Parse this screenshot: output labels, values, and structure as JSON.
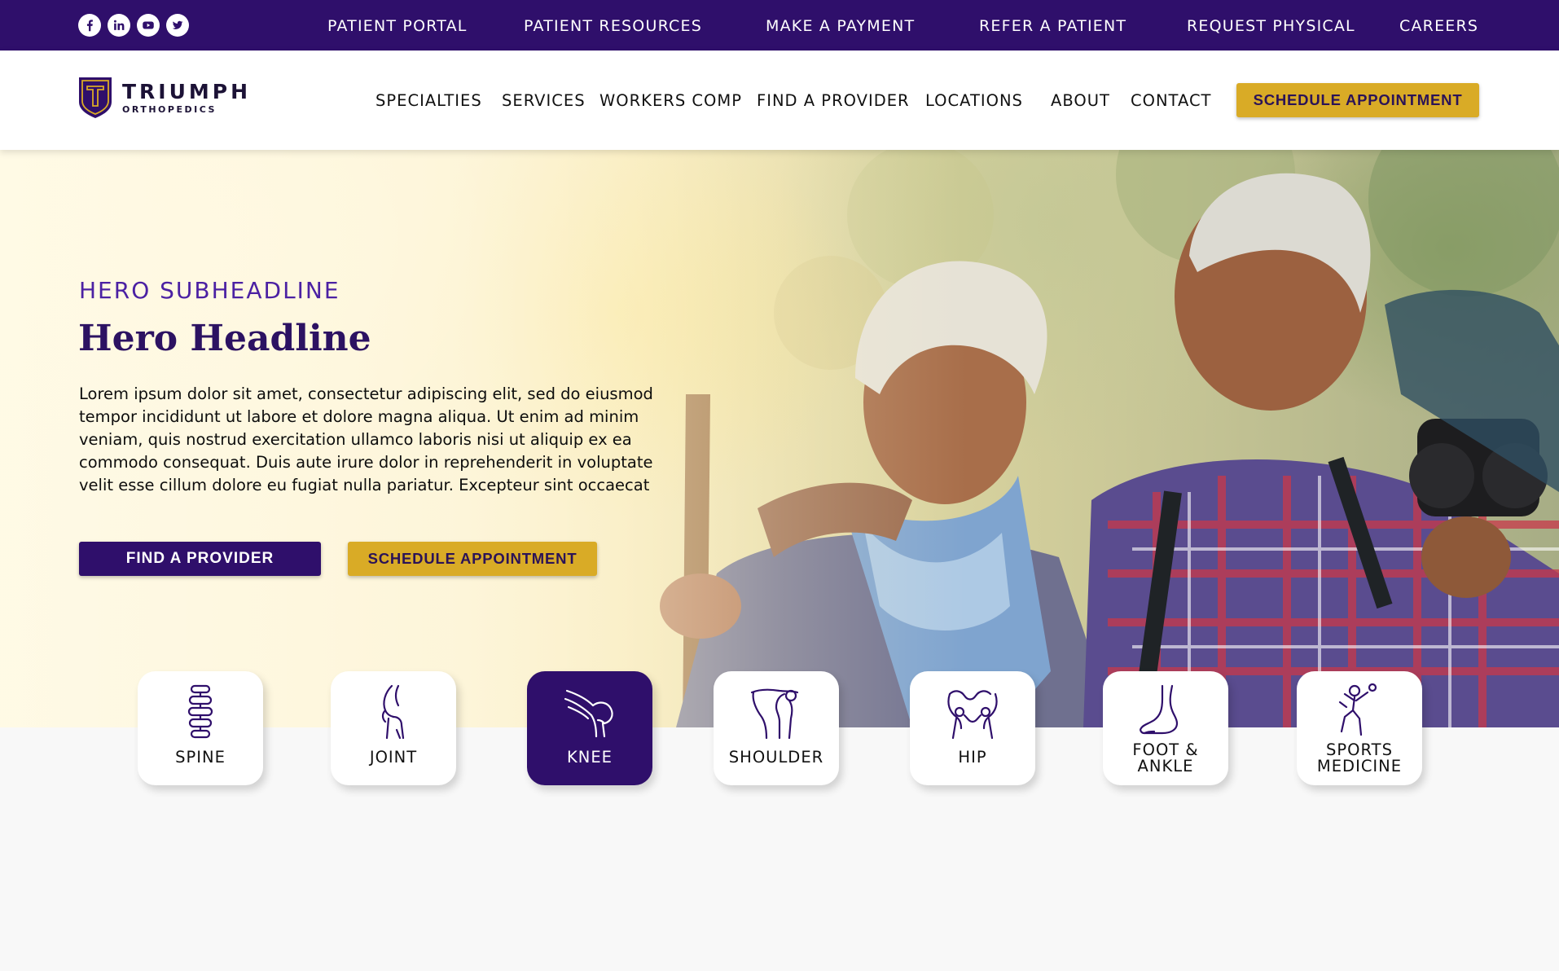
{
  "topbar": {
    "social": [
      "facebook-icon",
      "linkedin-icon",
      "youtube-icon",
      "twitter-icon"
    ],
    "links": [
      "PATIENT PORTAL",
      "PATIENT RESOURCES",
      "MAKE A PAYMENT",
      "REFER A PATIENT",
      "REQUEST PHYSICAL",
      "CAREERS"
    ]
  },
  "header": {
    "logo_name": "TRIUMPH",
    "logo_sub": "ORTHOPEDICS",
    "nav": [
      "SPECIALTIES",
      "SERVICES",
      "WORKERS COMP",
      "FIND A PROVIDER",
      "LOCATIONS",
      "ABOUT",
      "CONTACT"
    ],
    "cta": "SCHEDULE APPOINTMENT"
  },
  "hero": {
    "subheadline": "HERO SUBHEADLINE",
    "headline": "Hero Headline",
    "body": "Lorem ipsum dolor sit amet, consectetur adipiscing elit, sed do eiusmod tempor incididunt ut labore et dolore magna aliqua. Ut enim ad minim veniam, quis nostrud exercitation ullamco laboris nisi ut aliquip ex ea commodo consequat. Duis aute irure dolor in reprehenderit in voluptate velit esse cillum dolore eu fugiat nulla pariatur. Excepteur sint occaecat",
    "primary_button": "FIND A PROVIDER",
    "secondary_button": "SCHEDULE APPOINTMENT"
  },
  "specialties": [
    {
      "label": "SPINE",
      "icon": "spine-icon",
      "active": false
    },
    {
      "label": "JOINT",
      "icon": "joint-icon",
      "active": false
    },
    {
      "label": "KNEE",
      "icon": "knee-icon",
      "active": true
    },
    {
      "label": "SHOULDER",
      "icon": "shoulder-icon",
      "active": false
    },
    {
      "label": "HIP",
      "icon": "hip-icon",
      "active": false
    },
    {
      "label": "FOOT & ANKLE",
      "label_line1": "FOOT &",
      "label_line2": "ANKLE",
      "icon": "foot-ankle-icon",
      "active": false
    },
    {
      "label": "SPORTS MEDICINE",
      "label_line1": "SPORTS",
      "label_line2": "MEDICINE",
      "icon": "sports-medicine-icon",
      "active": false
    }
  ],
  "colors": {
    "brand_purple": "#2f0f6b",
    "accent_gold": "#d9ab26",
    "subheadline_purple": "#4b21a3"
  }
}
